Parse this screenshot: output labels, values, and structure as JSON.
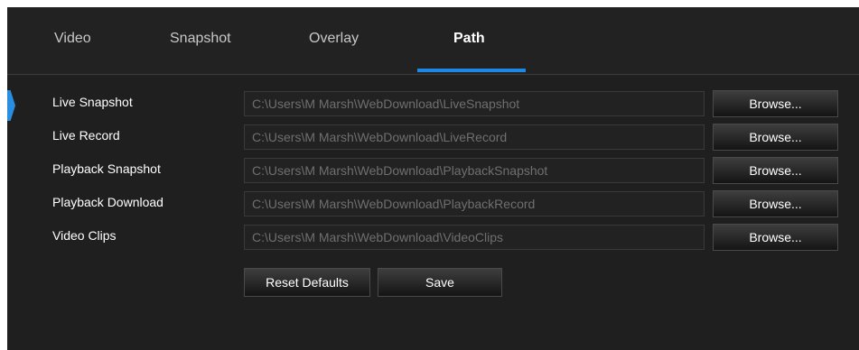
{
  "tabs": [
    {
      "label": "Video",
      "active": false
    },
    {
      "label": "Snapshot",
      "active": false
    },
    {
      "label": "Overlay",
      "active": false
    },
    {
      "label": "Path",
      "active": true
    }
  ],
  "rows": [
    {
      "label": "Live Snapshot",
      "path": "C:\\Users\\M Marsh\\WebDownload\\LiveSnapshot",
      "browse_label": "Browse..."
    },
    {
      "label": "Live Record",
      "path": "C:\\Users\\M Marsh\\WebDownload\\LiveRecord",
      "browse_label": "Browse..."
    },
    {
      "label": "Playback Snapshot",
      "path": "C:\\Users\\M Marsh\\WebDownload\\PlaybackSnapshot",
      "browse_label": "Browse..."
    },
    {
      "label": "Playback Download",
      "path": "C:\\Users\\M Marsh\\WebDownload\\PlaybackRecord",
      "browse_label": "Browse..."
    },
    {
      "label": "Video Clips",
      "path": "C:\\Users\\M Marsh\\WebDownload\\VideoClips",
      "browse_label": "Browse..."
    }
  ],
  "actions": {
    "reset_label": "Reset Defaults",
    "save_label": "Save"
  },
  "colors": {
    "background": "#1f1f1f",
    "accent": "#1e88e5",
    "field_text": "#6f6f6f"
  }
}
